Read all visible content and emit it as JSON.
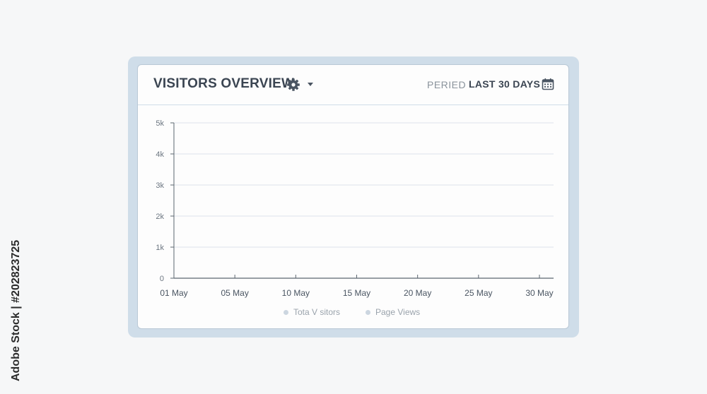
{
  "widget": {
    "title": "VISITORS OVERVIEW",
    "period_label": "PERIED",
    "period_value": "LAST 30 DAYS",
    "icons": {
      "settings": "gear-icon",
      "dropdown": "caret-down-icon",
      "calendar": "calendar-icon"
    }
  },
  "chart_data": {
    "type": "line",
    "title": "",
    "xlabel": "",
    "ylabel": "",
    "x_ticks": [
      "01 May",
      "05 May",
      "10 May",
      "15 May",
      "20 May",
      "25 May",
      "30 May"
    ],
    "y_ticks": [
      "0",
      "1k",
      "2k",
      "3k",
      "4k",
      "5k"
    ],
    "ylim": [
      0,
      5000
    ],
    "grid": true,
    "legend_position": "bottom",
    "series": [
      {
        "name": "Tota V sitors",
        "values": []
      },
      {
        "name": "Page Views",
        "values": []
      }
    ]
  },
  "colors": {
    "frame": "#cfdde9",
    "title_text": "#3b4552",
    "grid": "#dde4ea",
    "axis": "#5c6670"
  },
  "watermark": "Adobe Stock | #202823725"
}
